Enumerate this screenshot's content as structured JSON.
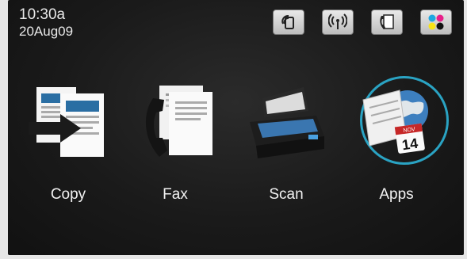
{
  "status": {
    "time": "10:30a",
    "date": "20Aug09"
  },
  "toolbar": {
    "icons": [
      "hp-eprint-icon",
      "wireless-icon",
      "fax-phone-icon",
      "ink-levels-icon"
    ]
  },
  "tiles": [
    {
      "label": "Copy",
      "icon": "copy-icon"
    },
    {
      "label": "Fax",
      "icon": "fax-icon"
    },
    {
      "label": "Scan",
      "icon": "scan-icon"
    },
    {
      "label": "Apps",
      "icon": "apps-icon"
    }
  ],
  "calendar": {
    "month": "NOV",
    "day": "14"
  },
  "colors": {
    "accent_ring": "#2aa3c3",
    "background": "#1a1a1a"
  }
}
